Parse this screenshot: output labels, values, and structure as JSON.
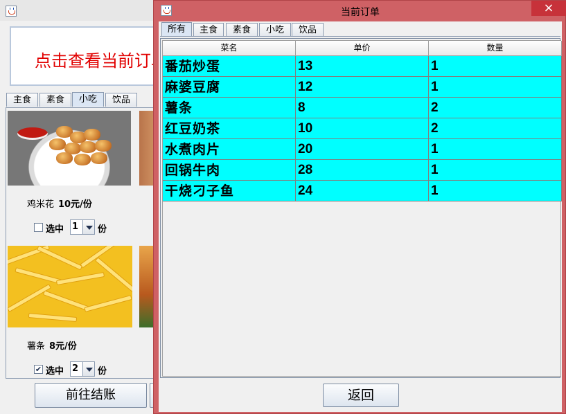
{
  "background_window": {
    "icon": "java-icon",
    "banner_text": "点击查看当前订单",
    "tabs": [
      {
        "label": "主食",
        "selected": false
      },
      {
        "label": "素食",
        "selected": false
      },
      {
        "label": "小吃",
        "selected": true
      },
      {
        "label": "饮品",
        "selected": false
      }
    ],
    "items": [
      {
        "name": "鸡米花",
        "price": "10元/份",
        "selected": false,
        "checkbox_label": "选中",
        "quantity": "1",
        "unit": "份"
      },
      {
        "name": "薯条",
        "price": "8元/份",
        "selected": true,
        "checkbox_label": "选中",
        "quantity": "2",
        "unit": "份"
      }
    ],
    "checkout_label": "前往结账"
  },
  "dialog": {
    "title": "当前订单",
    "close_glyph": "×",
    "titlebar_color": "#cf6165",
    "tabs": [
      {
        "label": "所有",
        "selected": true
      },
      {
        "label": "主食",
        "selected": false
      },
      {
        "label": "素食",
        "selected": false
      },
      {
        "label": "小吃",
        "selected": false
      },
      {
        "label": "饮品",
        "selected": false
      }
    ],
    "table": {
      "columns": [
        "菜名",
        "单价",
        "数量"
      ],
      "row_color": "#00ffff",
      "rows": [
        [
          "番茄炒蛋",
          "13",
          "1"
        ],
        [
          "麻婆豆腐",
          "12",
          "1"
        ],
        [
          "薯条",
          "8",
          "2"
        ],
        [
          "红豆奶茶",
          "10",
          "2"
        ],
        [
          "水煮肉片",
          "20",
          "1"
        ],
        [
          "回锅牛肉",
          "28",
          "1"
        ],
        [
          "干烧刁子鱼",
          "24",
          "1"
        ]
      ]
    },
    "return_label": "返回"
  }
}
